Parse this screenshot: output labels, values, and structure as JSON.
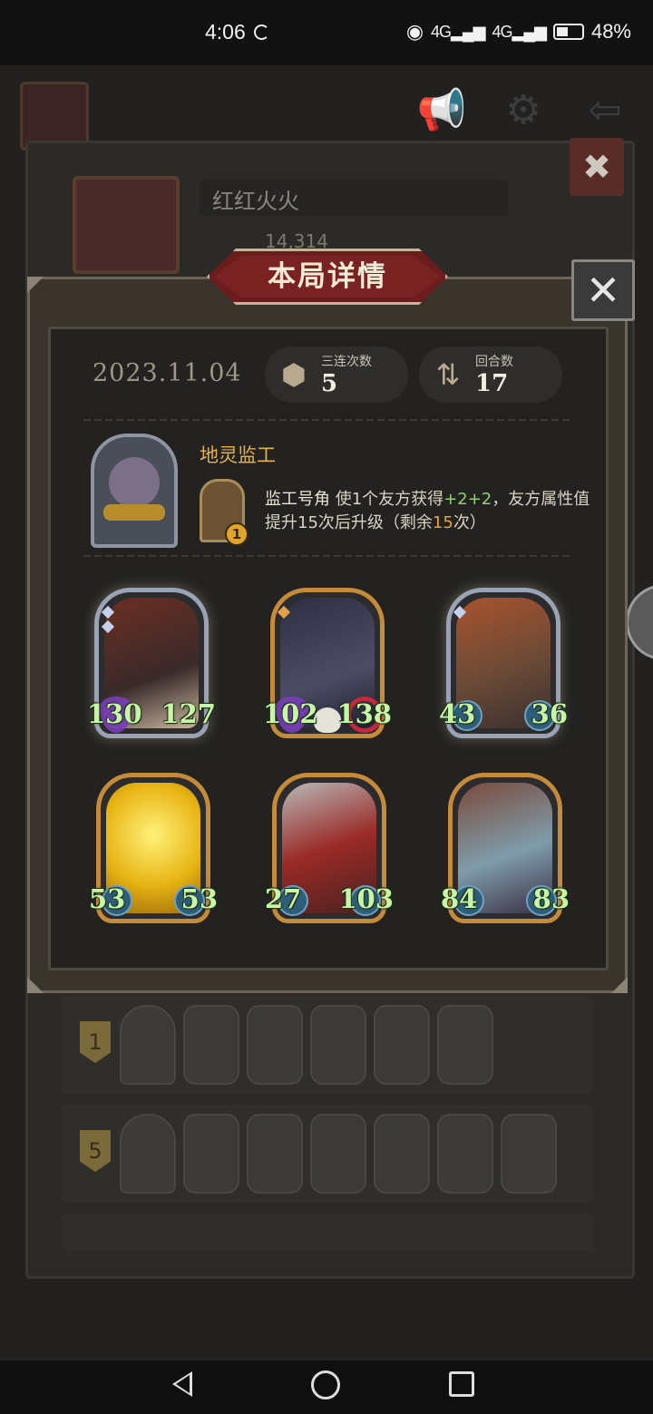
{
  "status_bar": {
    "time": "4:06",
    "signal1": "4G",
    "signal2": "4G",
    "battery": "48%"
  },
  "background": {
    "player_name": "红红火火",
    "score": "14,314",
    "rows": [
      {
        "badge": "1"
      },
      {
        "badge": "5"
      }
    ]
  },
  "modal": {
    "title": "本局详情",
    "close_icon": "close-icon",
    "date": "2023.11.04",
    "stats": [
      {
        "label": "三连次数",
        "value": "5",
        "icon": "triple-icon"
      },
      {
        "label": "回合数",
        "value": "17",
        "icon": "turns-icon"
      }
    ],
    "hero": {
      "name": "地灵监工",
      "skill_name": "监工号角",
      "skill_desc_1": "使1个友方获得",
      "skill_buff": "+2+2",
      "skill_desc_2": "，友方属性值提升15次后升级（剩余",
      "skill_remaining": "15",
      "skill_desc_3": "次）",
      "skill_coin": "1"
    },
    "cards": [
      {
        "atk": "130",
        "hp": "127",
        "frame": "silver",
        "art": "#5b2a22"
      },
      {
        "atk": "102",
        "hp": "138",
        "frame": "silver",
        "art": "#3b3b55"
      },
      {
        "atk": "43",
        "hp": "36",
        "frame": "silver",
        "art": "#7a5a40"
      },
      {
        "atk": "53",
        "hp": "53",
        "frame": "gold",
        "art": "#c99a1a"
      },
      {
        "atk": "27",
        "hp": "103",
        "frame": "gold",
        "art": "#8a2e2a"
      },
      {
        "atk": "84",
        "hp": "83",
        "frame": "gold",
        "art": "#4f6a7a"
      }
    ]
  }
}
